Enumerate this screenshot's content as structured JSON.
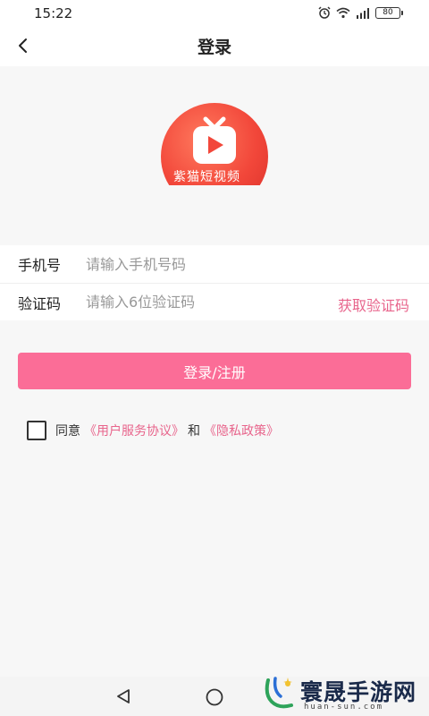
{
  "status_bar": {
    "time": "15:22",
    "battery": "80",
    "icons": [
      "alarm-icon",
      "wifi-icon",
      "signal-icon",
      "battery-icon"
    ]
  },
  "header": {
    "title": "登录",
    "back_icon": "back-arrow-icon"
  },
  "logo": {
    "caption": "紫猫短视频",
    "icon": "tv-play-icon"
  },
  "form": {
    "phone_label": "手机号",
    "phone_placeholder": "请输入手机号码",
    "phone_value": "",
    "code_label": "验证码",
    "code_placeholder": "请输入6位验证码",
    "code_value": "",
    "get_code_label": "获取验证码"
  },
  "login_button": {
    "label": "登录/注册"
  },
  "agreement": {
    "checked": false,
    "prefix": "同意",
    "service_link": "《用户服务协议》",
    "and": "和",
    "privacy_link": "《隐私政策》"
  },
  "system_nav": {
    "back_icon": "triangle-back-icon",
    "home_icon": "circle-home-icon"
  },
  "watermark": {
    "name": "寰晟手游网",
    "url": "huan-sun.com"
  },
  "colors": {
    "accent": "#fb6d97",
    "link": "#e8658c",
    "logo_red": "#f2473a",
    "background": "#f7f7f7"
  }
}
